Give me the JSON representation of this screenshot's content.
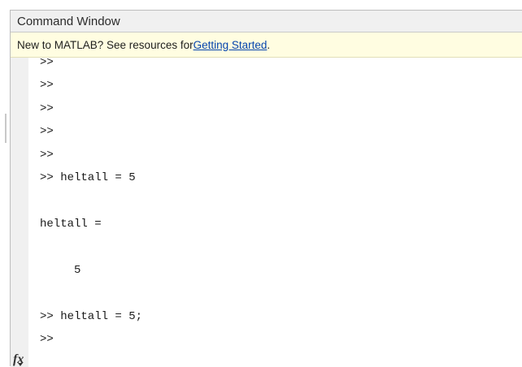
{
  "window": {
    "title": "Command Window"
  },
  "banner": {
    "prefix": "New to MATLAB? See resources for ",
    "link": "Getting Started",
    "suffix": "."
  },
  "console": {
    "lines": [
      ">>",
      ">>",
      ">>",
      ">>",
      ">>",
      ">> heltall = 5",
      "heltall =",
      "     5",
      ">> heltall = 5;",
      ">>"
    ]
  },
  "icons": {
    "fx": "fx-function-browser-icon"
  }
}
